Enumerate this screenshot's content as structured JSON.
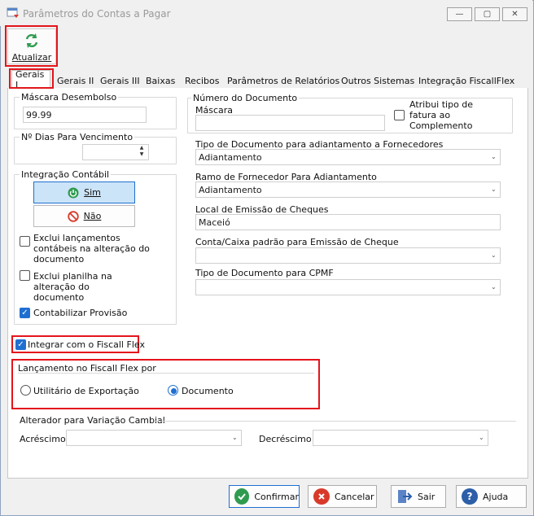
{
  "window": {
    "title": "Parâmetros do Contas a Pagar",
    "min_glyph": "—",
    "max_glyph": "▢",
    "close_glyph": "✕"
  },
  "toolbar": {
    "refresh_label": "Atualizar",
    "refresh_icon": "refresh-icon"
  },
  "tabs": [
    {
      "label": "Gerais I",
      "active": true
    },
    {
      "label": "Gerais II"
    },
    {
      "label": "Gerais III"
    },
    {
      "label": "Baixas"
    },
    {
      "label": "Recibos"
    },
    {
      "label": "Parâmetros de Relatórios"
    },
    {
      "label": "Outros Sistemas"
    },
    {
      "label": "Integração FiscallFlex"
    }
  ],
  "left": {
    "mascara_desembolso": {
      "label": "Máscara Desembolso",
      "value": "99.99"
    },
    "dias_vencimento": {
      "label": "Nº Dias Para Vencimento",
      "value": "",
      "up": "▲",
      "down": "▼"
    },
    "integracao": {
      "label": "Integração Contábil",
      "sim_label": "Sim",
      "nao_label": "Não",
      "exclui_lancamentos": "Exclui lançamentos contábeis na alteração do documento",
      "exclui_planilha": "Exclui planilha na alteração do documento",
      "contabilizar_provisao": "Contabilizar Provisão",
      "contabilizar_provisao_checked": true,
      "check_glyph": "✓"
    }
  },
  "right": {
    "numero_documento": {
      "label": "Número do Documento",
      "mascara_label": "Máscara",
      "mascara_value": ""
    },
    "atribui_tipo": "Atribui tipo de fatura ao Complemento",
    "tipo_doc_adiantamento": {
      "label": "Tipo de Documento para adiantamento a Fornecedores",
      "value": "Adiantamento"
    },
    "ramo_fornecedor": {
      "label": "Ramo de Fornecedor Para Adiantamento",
      "value": "Adiantamento"
    },
    "local_emissao": {
      "label": "Local de Emissão de Cheques",
      "value": "Maceió"
    },
    "conta_caixa": {
      "label": "Conta/Caixa padrão para Emissão de Cheque",
      "value": ""
    },
    "tipo_doc_cpmf": {
      "label": "Tipo de Documento para CPMF",
      "value": ""
    },
    "dropdown_glyph": "⌄"
  },
  "fiscall": {
    "integrar_label": "Integrar com o Fiscall Flex",
    "integrar_checked": true,
    "lancamento_label": "Lançamento no Fiscall Flex por",
    "opt_utilitario": "Utilitário de Exportação",
    "opt_documento": "Documento",
    "selected": "Documento"
  },
  "cambial": {
    "label": "Alterador para Variação Cambial",
    "acrescimo_label": "Acréscimo",
    "acrescimo_value": "",
    "decrescimo_label": "Decréscimo",
    "decrescimo_value": ""
  },
  "footer": {
    "confirmar": "Confirmar",
    "cancelar": "Cancelar",
    "sair": "Sair",
    "ajuda": "Ajuda"
  },
  "colors": {
    "accent": "#1f6fd1",
    "highlight_border": "#e4141b",
    "confirm_green": "#2e9b4f",
    "cancel_red": "#d83a2a"
  }
}
